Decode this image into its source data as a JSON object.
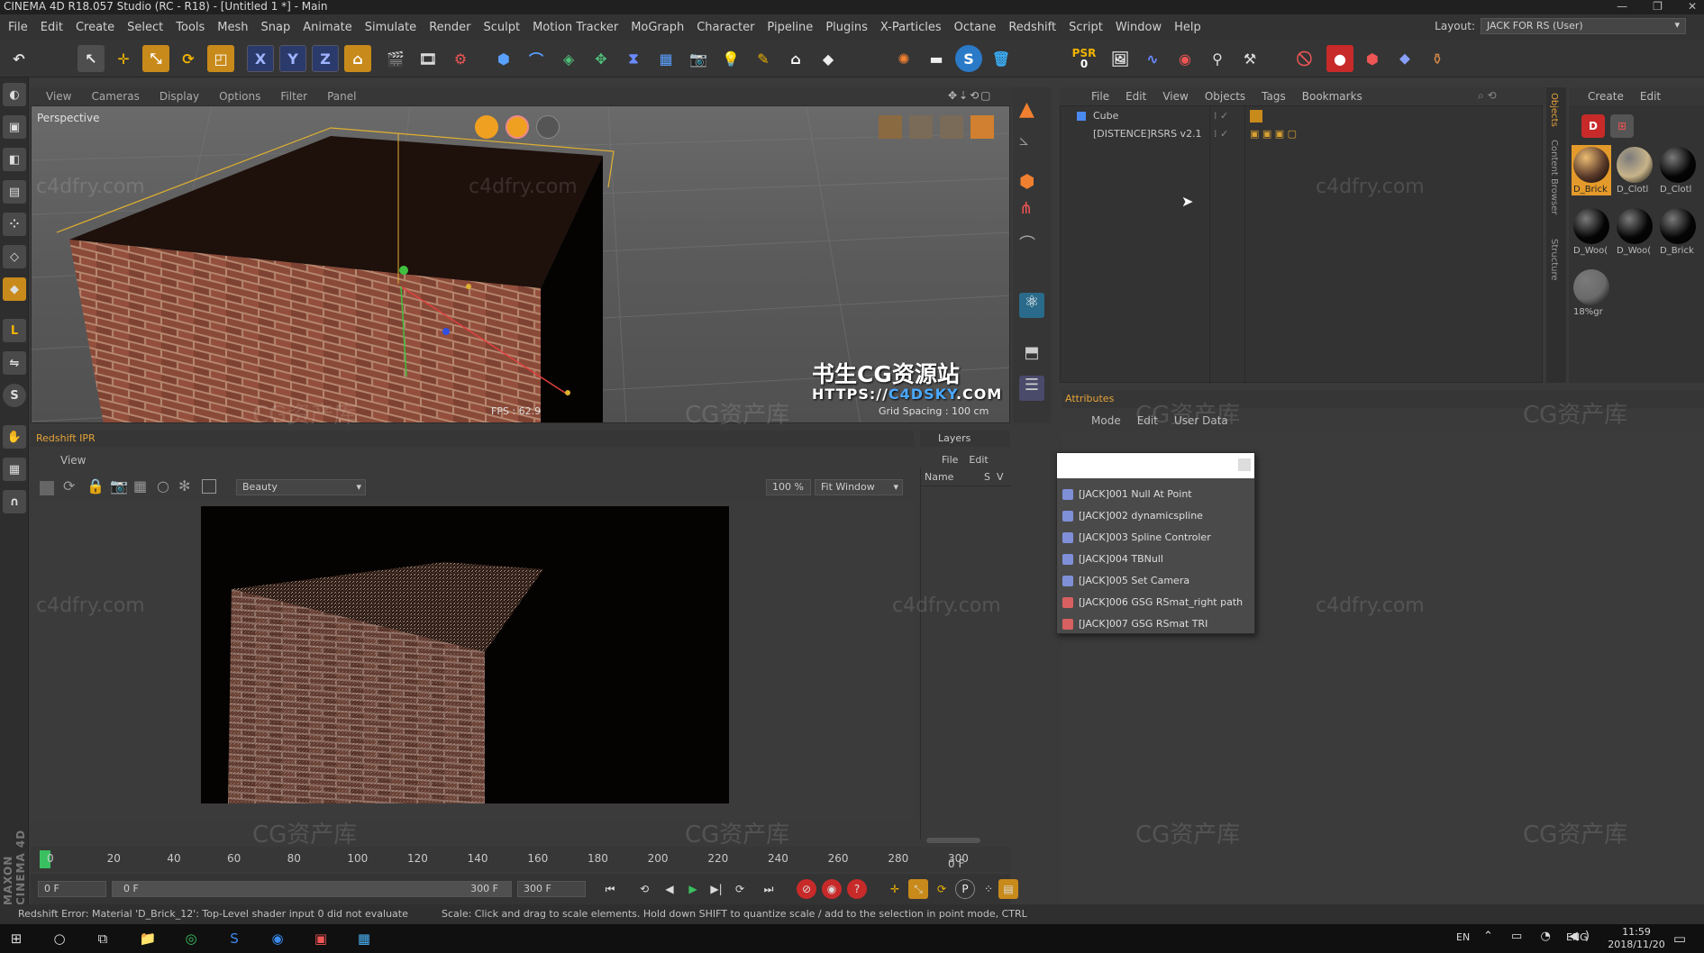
{
  "window": {
    "title": "CINEMA 4D R18.057 Studio (RC - R18) - [Untitled 1 *] - Main",
    "controls": [
      "—",
      "❐",
      "✕"
    ]
  },
  "menubar": {
    "items": [
      "File",
      "Edit",
      "Create",
      "Select",
      "Tools",
      "Mesh",
      "Snap",
      "Animate",
      "Simulate",
      "Render",
      "Sculpt",
      "Motion Tracker",
      "MoGraph",
      "Character",
      "Pipeline",
      "Plugins",
      "X-Particles",
      "Octane",
      "Redshift",
      "Script",
      "Window",
      "Help"
    ],
    "layout_label": "Layout:",
    "layout_value": "JACK FOR RS (User)"
  },
  "toolbar": {
    "psr_label": "PSR",
    "psr_value": "0",
    "axis_x": "X",
    "axis_y": "Y",
    "axis_z": "Z"
  },
  "viewport": {
    "menu": [
      "View",
      "Cameras",
      "Display",
      "Options",
      "Filter",
      "Panel"
    ],
    "label": "Perspective",
    "fps": "FPS : 62.9",
    "grid_spacing": "Grid Spacing : 100 cm",
    "banner_cn": "书生CG资源站",
    "banner_url_prefix": "HTTPS://",
    "banner_url_accent": "C4DSKY",
    "banner_url_suffix": ".COM"
  },
  "object_manager": {
    "menu": [
      "File",
      "Edit",
      "View",
      "Objects",
      "Tags",
      "Bookmarks"
    ],
    "objects": [
      {
        "name": "Cube",
        "color": "#e4a33a"
      },
      {
        "name": "[DISTENCE]RSRS v2.1",
        "color": "#aaaaaa"
      }
    ]
  },
  "material_manager": {
    "menu": [
      "Create",
      "Edit"
    ],
    "side_tabs": [
      "Objects",
      "Content Browser",
      "Structure"
    ],
    "materials": [
      {
        "name": "D_Brick",
        "color": "#5a3a2a",
        "selected": true
      },
      {
        "name": "D_Clotl",
        "color": "#c8b48a",
        "selected": false
      },
      {
        "name": "D_Clotl",
        "color": "#050505",
        "selected": false
      },
      {
        "name": "D_Woo(",
        "color": "#050505",
        "selected": false
      },
      {
        "name": "D_Woo(",
        "color": "#050505",
        "selected": false
      },
      {
        "name": "D_Brick",
        "color": "#050505",
        "selected": false
      },
      {
        "name": "18%gr",
        "color": "#6a6a6a",
        "selected": false
      }
    ]
  },
  "attributes": {
    "title": "Attributes",
    "menu": [
      "Mode",
      "Edit",
      "User Data"
    ]
  },
  "dropdown": {
    "items": [
      {
        "label": "[JACK]001 Null At Point",
        "color": "#7f8fd8"
      },
      {
        "label": "[JACK]002 dynamicspline",
        "color": "#7f8fd8"
      },
      {
        "label": "[JACK]003 Spline Controler",
        "color": "#7f8fd8"
      },
      {
        "label": "[JACK]004 TBNull",
        "color": "#7f8fd8"
      },
      {
        "label": "[JACK]005 Set Camera",
        "color": "#7f8fd8"
      },
      {
        "label": "[JACK]006 GSG RSmat_right path",
        "color": "#d86060"
      },
      {
        "label": "[JACK]007 GSG RSmat TRI",
        "color": "#d86060"
      }
    ]
  },
  "ipr": {
    "title": "Redshift IPR",
    "menu": [
      "View"
    ],
    "aov": "Beauty",
    "zoom": "100 %",
    "fit": "Fit Window"
  },
  "layers": {
    "title": "Layers",
    "menu": [
      "File",
      "Edit"
    ],
    "col_name": "Name",
    "col_s": "S",
    "col_v": "V"
  },
  "timeline": {
    "ticks": [
      "0",
      "20",
      "40",
      "60",
      "80",
      "100",
      "120",
      "140",
      "160",
      "180",
      "200",
      "220",
      "240",
      "260",
      "280",
      "300"
    ],
    "end_frame": "0 F",
    "current_frame": "0 F",
    "range_start": "0 F",
    "range_end": "300 F",
    "max_frame": "300 F"
  },
  "status": {
    "error": "Redshift Error: Material 'D_Brick_12': Top-Level shader input 0 did not evaluate",
    "hint": "Scale: Click and drag to scale elements. Hold down SHIFT to quantize scale / add to the selection in point mode, CTRL"
  },
  "taskbar": {
    "lang1": "EN",
    "lang2": "ENG",
    "time": "11:59",
    "date": "2018/11/20"
  },
  "maxon_label": "MAXON CINEMA 4D",
  "watermarks": {
    "site": "c4dfry.com",
    "cn": "CG资产库"
  }
}
